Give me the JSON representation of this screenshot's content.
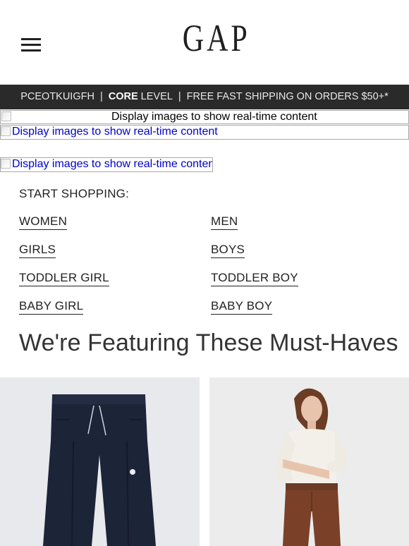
{
  "header": {
    "menu_icon": "hamburger-menu-icon",
    "logo_text": "GAP"
  },
  "promo_bar": {
    "member_id": "PCEOTKUIGFH",
    "separator": "|",
    "level_bold": "CORE",
    "level_rest": "LEVEL",
    "shipping": "FREE FAST SHIPPING ON ORDERS $50+*"
  },
  "image_placeholders": [
    "Display images to show real-time content",
    "Display images to show real-time content",
    "Display images to show real-time content"
  ],
  "start_shopping": {
    "label": "START SHOPPING:",
    "links": [
      "WOMEN",
      "MEN",
      "GIRLS",
      "BOYS",
      "TODDLER GIRL",
      "TODDLER BOY",
      "BABY GIRL",
      "BABY BOY"
    ]
  },
  "featured": {
    "title": "We're Featuring These Must-Haves",
    "products": [
      {
        "image": "navy-jogger-pants-image",
        "accent": "#1c2438"
      },
      {
        "image": "woman-white-sweater-brown-cords-image",
        "accent": "#6e3a22"
      }
    ]
  },
  "colors": {
    "promo_bg": "#2a2a2a",
    "link_blue": "#0000cc",
    "text": "#222222"
  }
}
